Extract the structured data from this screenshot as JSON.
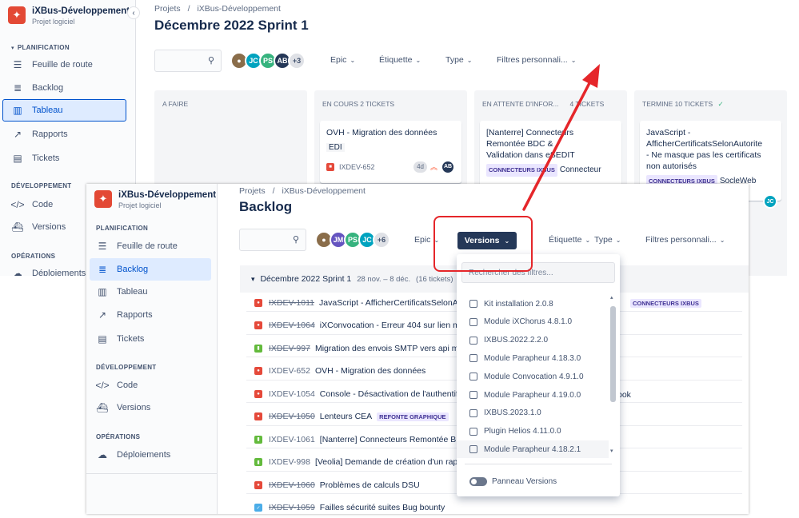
{
  "bg": {
    "project": {
      "name": "iXBus-Développement",
      "type": "Projet logiciel"
    },
    "sections": {
      "planification": "PLANIFICATION",
      "developpement": "DÉVELOPPEMENT",
      "operations": "OPÉRATIONS"
    },
    "nav": [
      "Feuille de route",
      "Backlog",
      "Tableau",
      "Rapports",
      "Tickets",
      "Code",
      "Versions",
      "Déploiements"
    ],
    "breadcrumb": {
      "root": "Projets",
      "sep": "/",
      "project": "iXBus-Développement"
    },
    "title": "Décembre 2022 Sprint 1",
    "avatars": [
      "JC",
      "PS",
      "AB",
      "+3"
    ],
    "filters": [
      "Epic",
      "Étiquette",
      "Type",
      "Filtres personnali..."
    ],
    "columns": [
      {
        "title": "A FAIRE"
      },
      {
        "title": "EN COURS 2 TICKETS"
      },
      {
        "title": "EN ATTENTE D'INFOR...",
        "count": "4 TICKETS"
      },
      {
        "title": "TERMINE 10 TICKETS",
        "check": "✓"
      }
    ],
    "cards": {
      "c1_title": "OVH - Migration des données",
      "c1_tag": "EDI",
      "c1_key": "IXDEV-652",
      "c1_estimate": "4d",
      "c1_avatar": "AB",
      "c2_title": "[Nanterre] Connecteurs Remontée BDC & Validation dans eSEDIT",
      "c2_epic": "CONNECTEURS IXBUS",
      "c2_tag": "Connecteur",
      "c3_title": "JavaScript - AfficherCertificatsSelonAutorite - Ne masque pas les certificats non autorisés",
      "c3_epic": "CONNECTEURS IXBUS",
      "c3_tag": "SocleWeb",
      "c3_avatar": "JC"
    }
  },
  "fg": {
    "project": {
      "name": "iXBus-Développement",
      "type": "Projet logiciel"
    },
    "sections": {
      "planification": "PLANIFICATION",
      "developpement": "DÉVELOPPEMENT",
      "operations": "OPÉRATIONS"
    },
    "nav": [
      "Feuille de route",
      "Backlog",
      "Tableau",
      "Rapports",
      "Tickets",
      "Code",
      "Versions",
      "Déploiements"
    ],
    "breadcrumb": {
      "root": "Projets",
      "sep": "/",
      "project": "iXBus-Développement"
    },
    "title": "Backlog",
    "avatars": [
      "JM",
      "PS",
      "JC",
      "+6"
    ],
    "filters": {
      "epic": "Epic",
      "versions": "Versions",
      "etiquette": "Étiquette",
      "type": "Type",
      "custom": "Filtres personnali..."
    },
    "sprint": {
      "name": "Décembre 2022 Sprint 1",
      "dates": "28 nov. – 8 déc.",
      "count": "(16 tickets)"
    },
    "issues": [
      {
        "type": "bug",
        "key": "IXDEV-1011",
        "done": true,
        "summary": "JavaScript - AfficherCertificatsSelonAutor"
      },
      {
        "type": "bug",
        "key": "IXDEV-1064",
        "done": true,
        "summary": "iXConvocation - Erreur 404 sur lien mail"
      },
      {
        "type": "story",
        "key": "IXDEV-997",
        "done": true,
        "summary": "Migration des envois SMTP vers api mailje"
      },
      {
        "type": "bug",
        "key": "IXDEV-652",
        "done": false,
        "summary": "OVH - Migration des données"
      },
      {
        "type": "bug",
        "key": "IXDEV-1054",
        "done": false,
        "summary": "Console - Désactivation de l'authentificat"
      },
      {
        "type": "bug",
        "key": "IXDEV-1050",
        "done": true,
        "summary": "Lenteurs CEA",
        "epic": "REFONTE GRAPHIQUE"
      },
      {
        "type": "story",
        "key": "IXDEV-1061",
        "done": false,
        "summary": "[Nanterre] Connecteurs Remontée BDC &"
      },
      {
        "type": "story",
        "key": "IXDEV-998",
        "done": false,
        "summary": "[Veolia] Demande de création d'un rappor"
      },
      {
        "type": "bug",
        "key": "IXDEV-1060",
        "done": true,
        "summary": "Problèmes de calculs DSU"
      },
      {
        "type": "task",
        "key": "IXDEV-1059",
        "done": true,
        "summary": "Failles sécurité suites Bug bounty"
      }
    ],
    "row_extras": {
      "epic1": "CONNECTEURS IXBUS",
      "ook": "ook"
    },
    "dropdown": {
      "search_placeholder": "Rechercher des filtres...",
      "options": [
        "Kit installation 2.0.8",
        "Module iXChorus 4.8.1.0",
        "IXBUS.2022.2.2.0",
        "Module Parapheur 4.18.3.0",
        "Module Convocation 4.9.1.0",
        "Module Parapheur 4.19.0.0",
        "IXBUS.2023.1.0",
        "Plugin Helios 4.11.0.0",
        "Module Parapheur 4.18.2.1"
      ],
      "panel_toggle": "Panneau Versions"
    }
  },
  "colors": {
    "accent": "#0052cc",
    "annotation": "#e5262a",
    "selected_button": "#253858"
  }
}
